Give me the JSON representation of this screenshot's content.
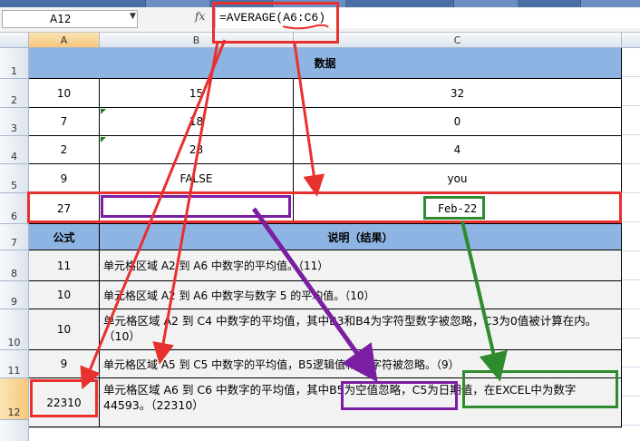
{
  "name_box": {
    "value": "A12"
  },
  "formula_bar": {
    "fx_label": "fx",
    "formula": "=AVERAGE(A6:C6)"
  },
  "columns": [
    "A",
    "B",
    "C"
  ],
  "rows": [
    "1",
    "2",
    "3",
    "4",
    "5",
    "6",
    "7",
    "8",
    "9",
    "10",
    "11",
    "12"
  ],
  "table": {
    "header_title": "数据",
    "data_rows": [
      {
        "a": "10",
        "b": "15",
        "c": "32"
      },
      {
        "a": "7",
        "b": "18",
        "c": "0"
      },
      {
        "a": "2",
        "b": "28",
        "c": "4"
      },
      {
        "a": "9",
        "b": "FALSE",
        "c": "you"
      },
      {
        "a": "27",
        "b": "",
        "c": "Feb-22"
      }
    ],
    "formula_header": "公式",
    "desc_header": "说明（结果）",
    "formula_rows": [
      {
        "value": "11",
        "desc": "单元格区域 A2 到 A6 中数字的平均值。（11）"
      },
      {
        "value": "10",
        "desc": "单元格区域 A2 到 A6 中数字与数字 5 的平均值。（10）"
      },
      {
        "value": "10",
        "desc": "单元格区域 A2 到 C4 中数字的平均值，其中B3和B4为字符型数字被忽略，C3为0值被计算在内。（10）"
      },
      {
        "value": "9",
        "desc": "单元格区域 A5 到 C5 中数字的平均值，B5逻辑值和C5字符被忽略。（9）"
      },
      {
        "value": "22310",
        "desc": "单元格区域 A6 到 C6 中数字的平均值，其中B5为空值忽略，C5为日期值，在EXCEL中为数字44593。（22310）"
      }
    ]
  },
  "colors": {
    "header_blue": "#8eb4e3",
    "annotation_red": "#e8312f",
    "annotation_purple": "#7b1fa2",
    "annotation_green": "#2e8b2e"
  }
}
